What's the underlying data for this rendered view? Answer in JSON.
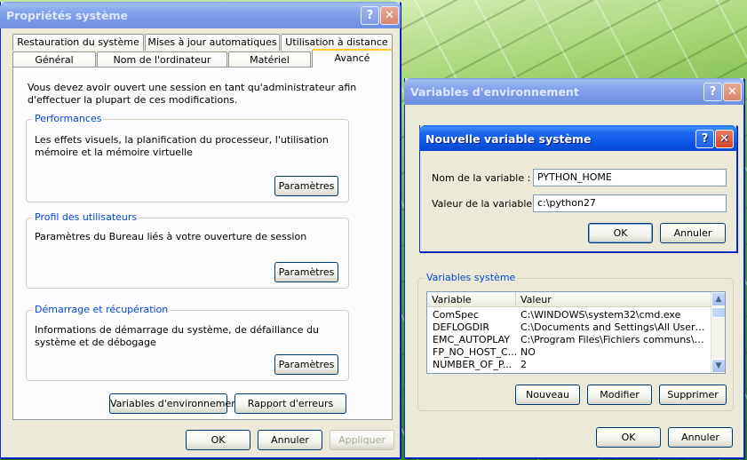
{
  "system_props": {
    "title": "Propriétés système",
    "tabs_row1": [
      "Restauration du système",
      "Mises à jour automatiques",
      "Utilisation à distance"
    ],
    "tabs_row2": [
      "Général",
      "Nom de l'ordinateur",
      "Matériel",
      "Avancé"
    ],
    "active_tab": "Avancé",
    "admin_notice": "Vous devez avoir ouvert une session en tant qu'administrateur afin d'effectuer la plupart de ces modifications.",
    "performance": {
      "title": "Performances",
      "description": "Les effets visuels, la planification du processeur, l'utilisation mémoire et la mémoire virtuelle",
      "button": "Paramètres"
    },
    "user_profiles": {
      "title": "Profil des utilisateurs",
      "description": "Paramètres du Bureau liés à votre ouverture de session",
      "button": "Paramètres"
    },
    "startup_recovery": {
      "title": "Démarrage et récupération",
      "description": "Informations de démarrage du système, de défaillance du système et de débogage",
      "button": "Paramètres"
    },
    "env_vars_button": "Variables d'environnement",
    "error_report_button": "Rapport d'erreurs",
    "ok": "OK",
    "cancel": "Annuler",
    "apply": "Appliquer"
  },
  "env_vars": {
    "title": "Variables d'environnement",
    "system_vars_title": "Variables système",
    "columns": [
      "Variable",
      "Valeur"
    ],
    "rows": [
      {
        "name": "ComSpec",
        "value": "C:\\WINDOWS\\system32\\cmd.exe"
      },
      {
        "name": "DEFLOGDIR",
        "value": "C:\\Documents and Settings\\All Users\\A..."
      },
      {
        "name": "EMC_AUTOPLAY",
        "value": "C:\\Program Files\\Fichiers communs\\Roxi..."
      },
      {
        "name": "FP_NO_HOST_C...",
        "value": "NO"
      },
      {
        "name": "NUMBER_OF_P...",
        "value": "2"
      }
    ],
    "new_button": "Nouveau",
    "edit_button": "Modifier",
    "delete_button": "Supprimer",
    "ok": "OK",
    "cancel": "Annuler"
  },
  "new_var": {
    "title": "Nouvelle variable système",
    "name_label": "Nom de la variable :",
    "name_value": "PYTHON_HOME",
    "value_label": "Valeur de la variable :",
    "value_value": "c:\\python27",
    "ok": "OK",
    "cancel": "Annuler"
  },
  "icons": {
    "help": "?",
    "close": "✕",
    "scroll_up": "▲",
    "scroll_down": "▼"
  }
}
